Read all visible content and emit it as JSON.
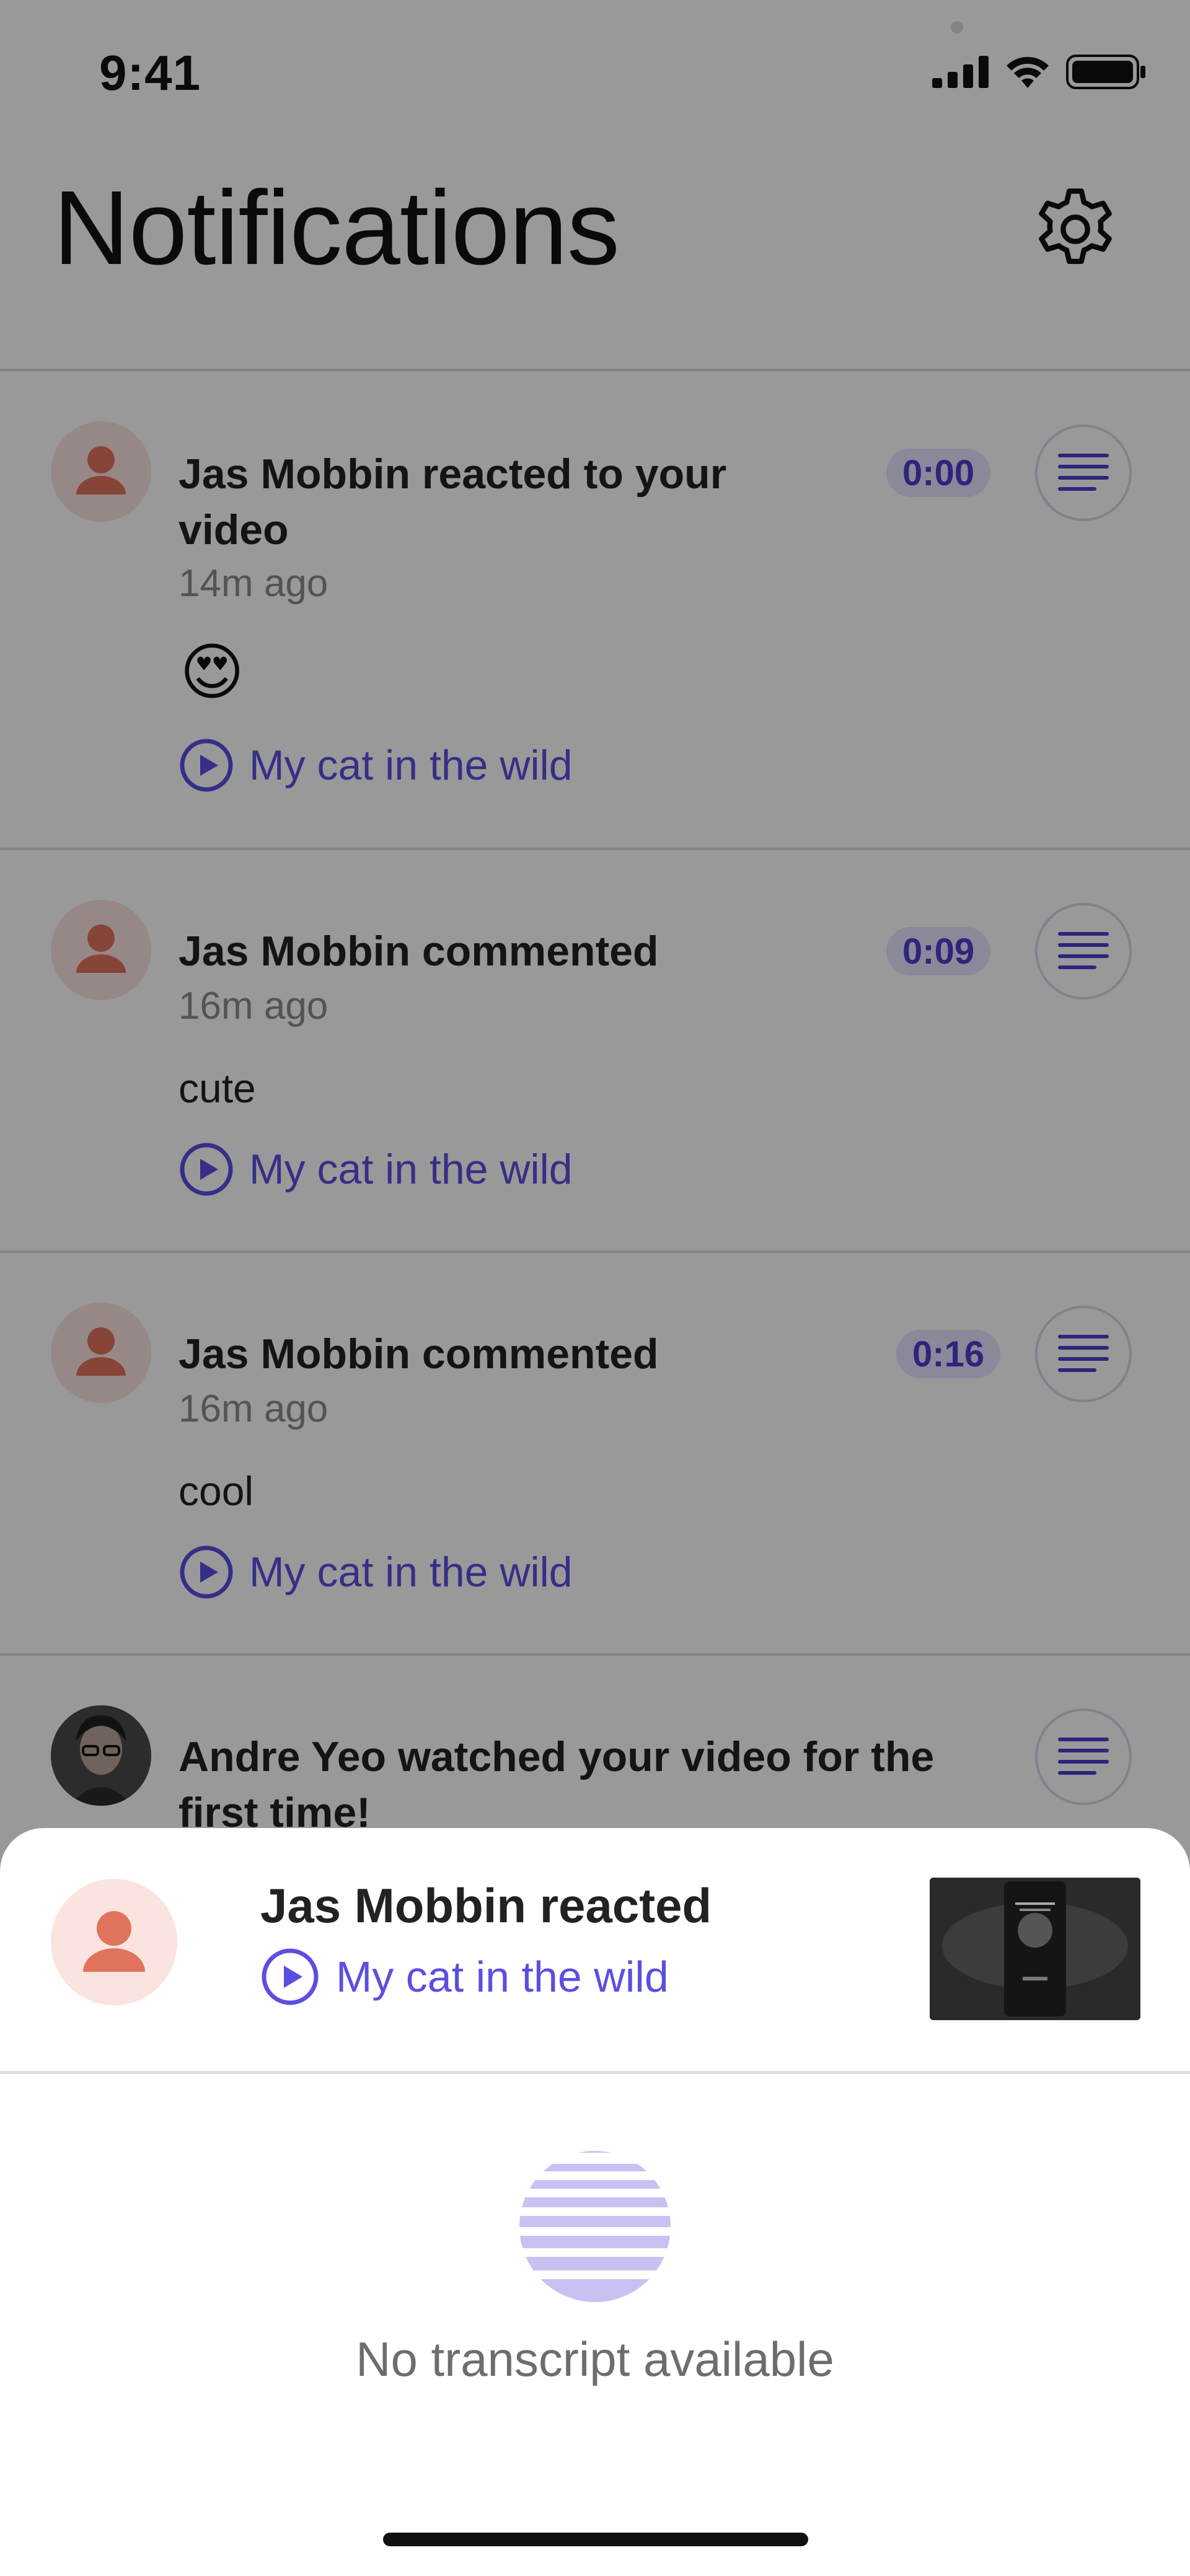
{
  "status_bar": {
    "time": "9:41"
  },
  "header": {
    "title": "Notifications"
  },
  "notifications": [
    {
      "headline": "Jas Mobbin  reacted to your video",
      "ago": "14m ago",
      "emoji": "😍",
      "video_title": "My cat in the wild",
      "timestamp": "0:00"
    },
    {
      "headline": "Jas Mobbin commented",
      "ago": "16m ago",
      "comment": "cute",
      "video_title": "My cat in the wild",
      "timestamp": "0:09"
    },
    {
      "headline": "Jas Mobbin commented",
      "ago": "16m ago",
      "comment": "cool",
      "video_title": "My cat in the wild",
      "timestamp": "0:16"
    },
    {
      "headline": "Andre Yeo watched your video for the first time!"
    }
  ],
  "sheet": {
    "title": "Jas Mobbin  reacted",
    "video_title": "My cat in the wild",
    "empty_message": "No transcript available"
  },
  "colors": {
    "accent": "#5b4fe0",
    "avatar_bg": "#fbe3df",
    "avatar_fg": "#e0735b",
    "badge_bg": "#e6e3ff"
  }
}
